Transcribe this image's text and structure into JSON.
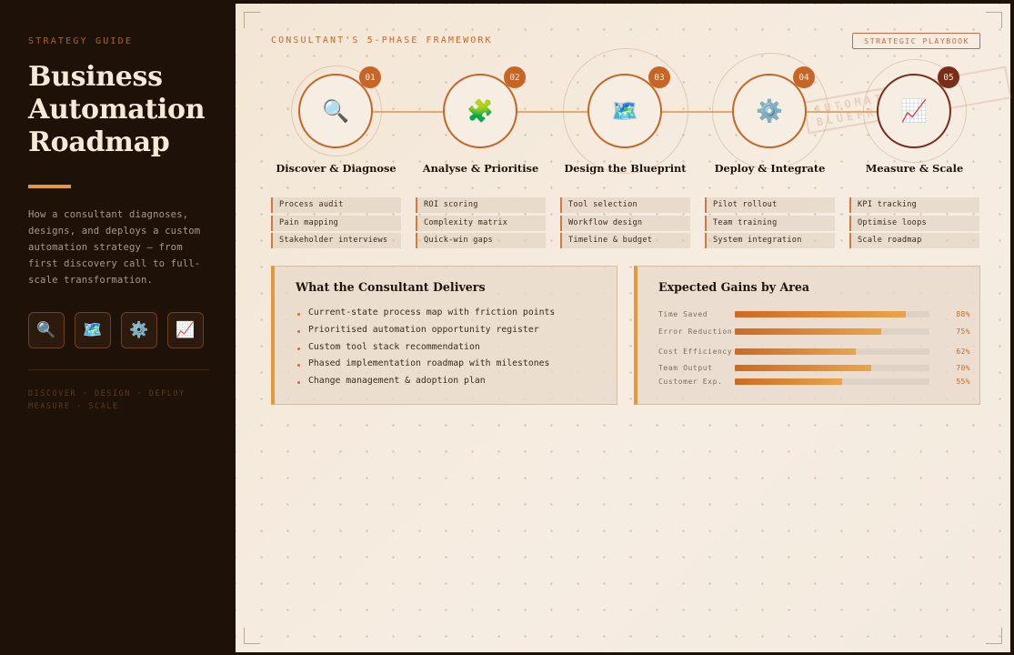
{
  "sidebar": {
    "eyebrow": "STRATEGY GUIDE",
    "title": "Business Automation Roadmap",
    "description": "How a consultant diagnoses, designs, and deploys a custom automation strategy — from first discovery call to full-scale transformation.",
    "icons": [
      "search-icon",
      "map-icon",
      "gear-icon",
      "chart-icon"
    ],
    "icon_glyphs": [
      "🔍",
      "🗺️",
      "⚙️",
      "📈"
    ],
    "footer": "DISCOVER · DESIGN · DEPLOY MEASURE · SCALE"
  },
  "main": {
    "framework_title": "CONSULTANT'S 5-PHASE FRAMEWORK",
    "badge": "STRATEGIC PLAYBOOK",
    "stamp": "AUTOMATION BLUEPRINT",
    "phases": [
      {
        "num": "01",
        "icon": "search-icon",
        "glyph": "🔍",
        "title": "Discover & Diagnose",
        "tasks": [
          "Process audit",
          "Pain mapping",
          "Stakeholder interviews"
        ]
      },
      {
        "num": "02",
        "icon": "puzzle-icon",
        "glyph": "🧩",
        "title": "Analyse & Prioritise",
        "tasks": [
          "ROI scoring",
          "Complexity matrix",
          "Quick-win gaps"
        ]
      },
      {
        "num": "03",
        "icon": "map-icon",
        "glyph": "🗺️",
        "title": "Design the Blueprint",
        "tasks": [
          "Tool selection",
          "Workflow design",
          "Timeline & budget"
        ]
      },
      {
        "num": "04",
        "icon": "gear-icon",
        "glyph": "⚙️",
        "title": "Deploy & Integrate",
        "tasks": [
          "Pilot rollout",
          "Team training",
          "System integration"
        ]
      },
      {
        "num": "05",
        "icon": "chart-icon",
        "glyph": "📈",
        "title": "Measure & Scale",
        "tasks": [
          "KPI tracking",
          "Optimise loops",
          "Scale roadmap"
        ]
      }
    ],
    "deliverables": {
      "title": "What the Consultant Delivers",
      "items": [
        "Current-state process map with friction points",
        "Prioritised automation opportunity register",
        "Custom tool stack recommendation",
        "Phased implementation roadmap with milestones",
        "Change management & adoption plan"
      ]
    },
    "gains": {
      "title": "Expected Gains by Area",
      "rows": [
        {
          "label": "Time Saved",
          "value": 88,
          "display": "88%"
        },
        {
          "label": "Error Reduction",
          "value": 75,
          "display": "75%"
        },
        {
          "label": "Cost Efficiency",
          "value": 62,
          "display": "62%"
        },
        {
          "label": "Team Output",
          "value": 70,
          "display": "70%"
        },
        {
          "label": "Customer Exp.",
          "value": 55,
          "display": "55%"
        }
      ]
    }
  },
  "colors": {
    "accent": "#c76527",
    "accent_light": "#e39a3c",
    "sidebar_bg": "#1e1208",
    "panel_bg": "#f3e8da"
  }
}
